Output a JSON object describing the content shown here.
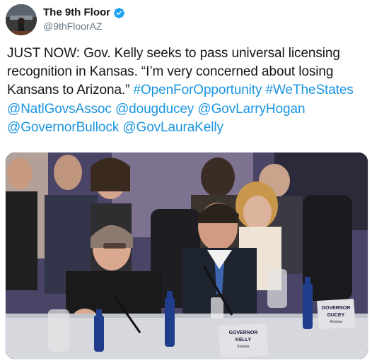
{
  "author": {
    "display_name": "The 9th Floor",
    "handle": "@9thFloorAZ",
    "verified": true,
    "avatar_icon": "avatar-photo"
  },
  "tweet": {
    "text_plain_1": "JUST NOW: Gov. Kelly seeks to pass universal licensing recognition in Kansas. “I’m very concerned about losing Kansans to Arizona.” ",
    "hashtag_1": "#OpenForOpportunity",
    "hashtag_2": "#WeTheStates",
    "mention_1": "@NatlGovsAssoc",
    "mention_2": "@dougducey",
    "mention_3": "@GovLarryHogan",
    "mention_4": "@GovernorBullock",
    "mention_5": "@GovLauraKelly"
  },
  "media": {
    "name_plate_left_line1": "GOVERNOR",
    "name_plate_left_line2": "KELLY",
    "name_plate_left_line3": "Kansas",
    "name_plate_right_line1": "GOVERNOR",
    "name_plate_right_line2": "DUCEY",
    "name_plate_right_line3": "Arizona"
  },
  "colors": {
    "link": "#1b95e0",
    "verified_badge": "#1da1f2",
    "text": "#14171a",
    "secondary_text": "#657786"
  }
}
